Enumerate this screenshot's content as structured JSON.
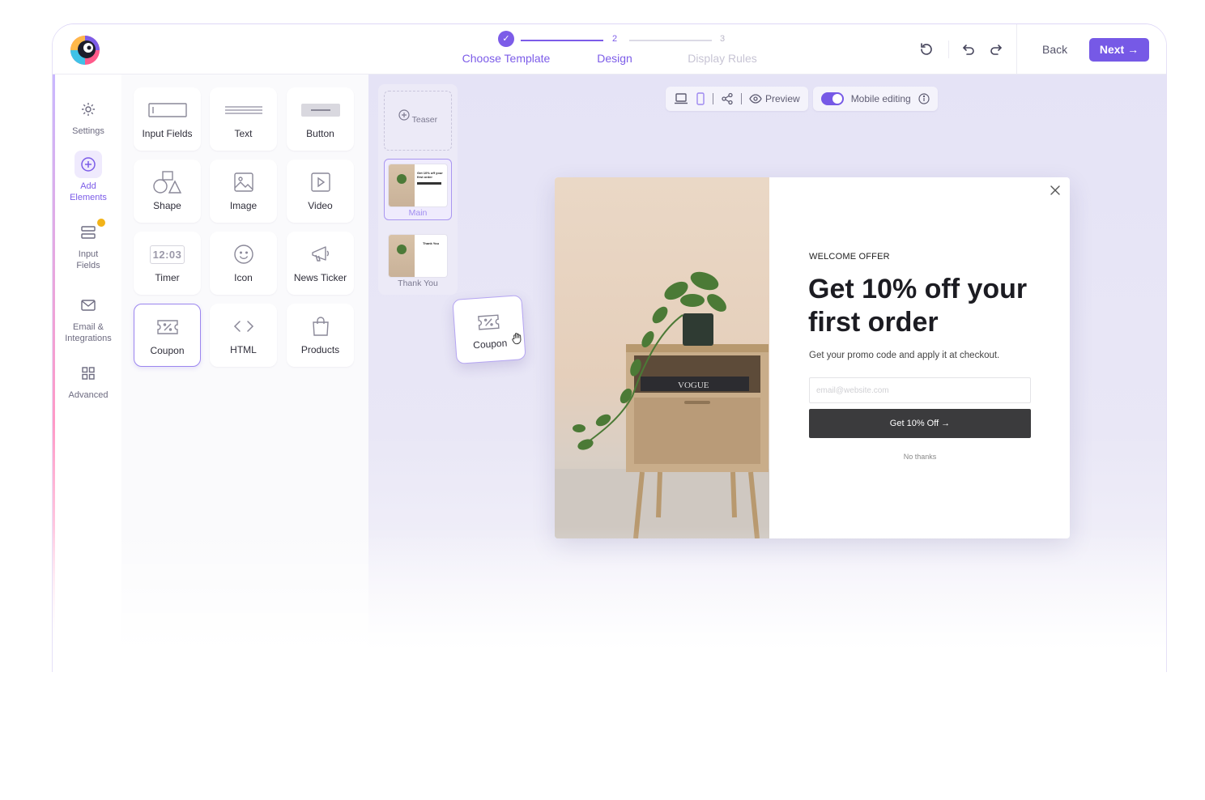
{
  "steps": [
    {
      "num": "✓",
      "label": "Choose Template",
      "state": "done"
    },
    {
      "num": "2",
      "label": "Design",
      "state": "current"
    },
    {
      "num": "3",
      "label": "Display Rules",
      "state": "future"
    }
  ],
  "header": {
    "back_label": "Back",
    "next_label": "Next",
    "next_arrow": "→"
  },
  "leftnav": {
    "settings": "Settings",
    "add_elements": "Add Elements",
    "input_fields": "Input Fields",
    "email_integrations": "Email & Integrations",
    "advanced": "Advanced"
  },
  "elements": {
    "input_fields": "Input Fields",
    "text": "Text",
    "button": "Button",
    "shape": "Shape",
    "image": "Image",
    "video": "Video",
    "timer": "Timer",
    "timer_display": "12:03",
    "icon": "Icon",
    "news_ticker": "News Ticker",
    "coupon": "Coupon",
    "html": "HTML",
    "products": "Products"
  },
  "pages": {
    "teaser": "Teaser",
    "main": "Main",
    "thank_you": "Thank You",
    "thumb_main_text": "Get 10% off your first order",
    "thumb_thanks_text": "Thank You"
  },
  "toolbar": {
    "preview": "Preview",
    "mobile_editing": "Mobile editing"
  },
  "drag_ghost": {
    "label": "Coupon"
  },
  "popup": {
    "eyebrow": "WELCOME OFFER",
    "headline": "Get 10% off your first order",
    "subtext": "Get your promo code and apply it at checkout.",
    "email_placeholder": "email@website.com",
    "cta": "Get 10% Off →",
    "no_thanks": "No thanks",
    "magazine": "VOGUE"
  },
  "colors": {
    "accent": "#7659e6",
    "cta": "#3b3b3d",
    "badge": "#f2b318"
  }
}
